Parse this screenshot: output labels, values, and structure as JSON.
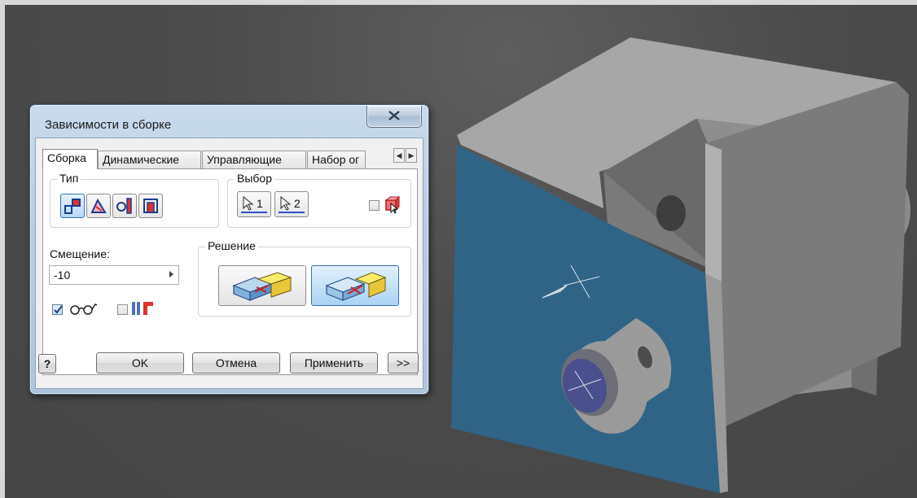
{
  "dialog": {
    "title": "Зависимости в сборке",
    "tabs": [
      "Сборка",
      "Динамические",
      "Управляющие",
      "Набор ог"
    ],
    "type_group_label": "Тип",
    "selection_group_label": "Выбор",
    "selection_1": "1",
    "selection_2": "2",
    "offset_label": "Смещение:",
    "offset_value": "-10",
    "solution_group_label": "Решение",
    "buttons": {
      "help": "?",
      "ok": "OK",
      "cancel": "Отмена",
      "apply": "Применить",
      "more": ">>"
    },
    "icons": [
      "close-icon",
      "mate-icon",
      "angle-icon",
      "tangent-icon",
      "insert-icon",
      "cursor-1-icon",
      "cursor-2-icon",
      "pick-part-icon",
      "glasses-icon",
      "limits-icon",
      "mate-solution-icon",
      "flush-solution-icon"
    ],
    "states": {
      "active_tab": "Сборка",
      "selected_type": "mate",
      "selected_solution": "flush",
      "glasses_checked": true,
      "limits_checked": false,
      "pick_part_checked": false
    }
  },
  "colors": {
    "viewport_bg": "#4b4b4b",
    "selected_face": "#2f6487",
    "dialog_frame": "#b9cde3"
  }
}
